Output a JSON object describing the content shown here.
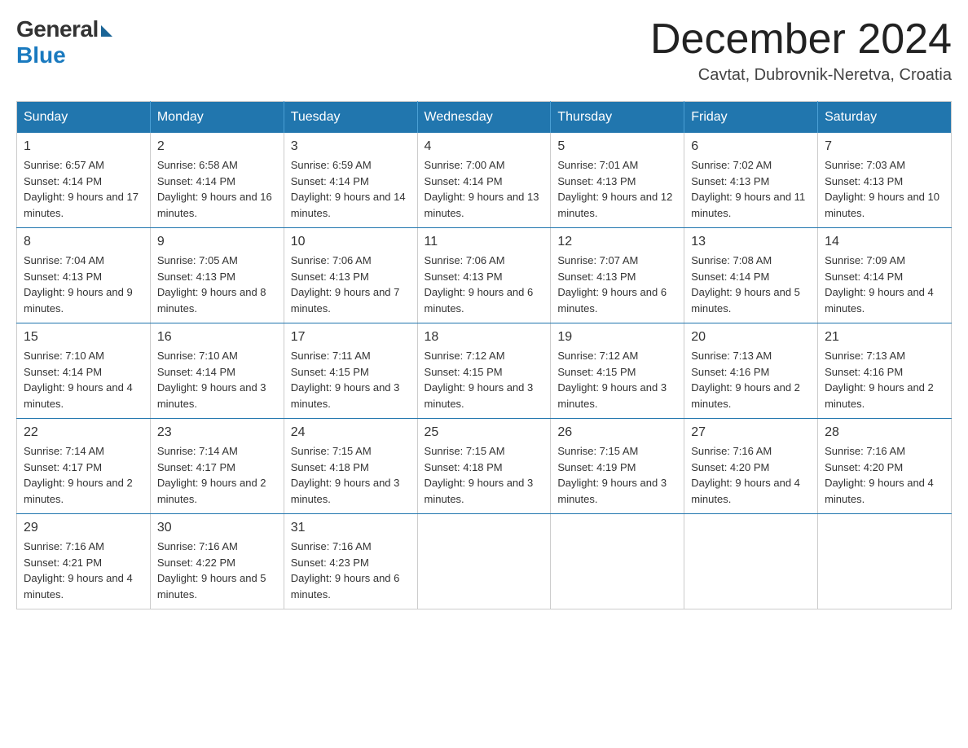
{
  "header": {
    "logo_general": "General",
    "logo_blue": "Blue",
    "month_year": "December 2024",
    "location": "Cavtat, Dubrovnik-Neretva, Croatia"
  },
  "days_of_week": [
    "Sunday",
    "Monday",
    "Tuesday",
    "Wednesday",
    "Thursday",
    "Friday",
    "Saturday"
  ],
  "weeks": [
    [
      {
        "day": "1",
        "sunrise": "6:57 AM",
        "sunset": "4:14 PM",
        "daylight": "9 hours and 17 minutes."
      },
      {
        "day": "2",
        "sunrise": "6:58 AM",
        "sunset": "4:14 PM",
        "daylight": "9 hours and 16 minutes."
      },
      {
        "day": "3",
        "sunrise": "6:59 AM",
        "sunset": "4:14 PM",
        "daylight": "9 hours and 14 minutes."
      },
      {
        "day": "4",
        "sunrise": "7:00 AM",
        "sunset": "4:14 PM",
        "daylight": "9 hours and 13 minutes."
      },
      {
        "day": "5",
        "sunrise": "7:01 AM",
        "sunset": "4:13 PM",
        "daylight": "9 hours and 12 minutes."
      },
      {
        "day": "6",
        "sunrise": "7:02 AM",
        "sunset": "4:13 PM",
        "daylight": "9 hours and 11 minutes."
      },
      {
        "day": "7",
        "sunrise": "7:03 AM",
        "sunset": "4:13 PM",
        "daylight": "9 hours and 10 minutes."
      }
    ],
    [
      {
        "day": "8",
        "sunrise": "7:04 AM",
        "sunset": "4:13 PM",
        "daylight": "9 hours and 9 minutes."
      },
      {
        "day": "9",
        "sunrise": "7:05 AM",
        "sunset": "4:13 PM",
        "daylight": "9 hours and 8 minutes."
      },
      {
        "day": "10",
        "sunrise": "7:06 AM",
        "sunset": "4:13 PM",
        "daylight": "9 hours and 7 minutes."
      },
      {
        "day": "11",
        "sunrise": "7:06 AM",
        "sunset": "4:13 PM",
        "daylight": "9 hours and 6 minutes."
      },
      {
        "day": "12",
        "sunrise": "7:07 AM",
        "sunset": "4:13 PM",
        "daylight": "9 hours and 6 minutes."
      },
      {
        "day": "13",
        "sunrise": "7:08 AM",
        "sunset": "4:14 PM",
        "daylight": "9 hours and 5 minutes."
      },
      {
        "day": "14",
        "sunrise": "7:09 AM",
        "sunset": "4:14 PM",
        "daylight": "9 hours and 4 minutes."
      }
    ],
    [
      {
        "day": "15",
        "sunrise": "7:10 AM",
        "sunset": "4:14 PM",
        "daylight": "9 hours and 4 minutes."
      },
      {
        "day": "16",
        "sunrise": "7:10 AM",
        "sunset": "4:14 PM",
        "daylight": "9 hours and 3 minutes."
      },
      {
        "day": "17",
        "sunrise": "7:11 AM",
        "sunset": "4:15 PM",
        "daylight": "9 hours and 3 minutes."
      },
      {
        "day": "18",
        "sunrise": "7:12 AM",
        "sunset": "4:15 PM",
        "daylight": "9 hours and 3 minutes."
      },
      {
        "day": "19",
        "sunrise": "7:12 AM",
        "sunset": "4:15 PM",
        "daylight": "9 hours and 3 minutes."
      },
      {
        "day": "20",
        "sunrise": "7:13 AM",
        "sunset": "4:16 PM",
        "daylight": "9 hours and 2 minutes."
      },
      {
        "day": "21",
        "sunrise": "7:13 AM",
        "sunset": "4:16 PM",
        "daylight": "9 hours and 2 minutes."
      }
    ],
    [
      {
        "day": "22",
        "sunrise": "7:14 AM",
        "sunset": "4:17 PM",
        "daylight": "9 hours and 2 minutes."
      },
      {
        "day": "23",
        "sunrise": "7:14 AM",
        "sunset": "4:17 PM",
        "daylight": "9 hours and 2 minutes."
      },
      {
        "day": "24",
        "sunrise": "7:15 AM",
        "sunset": "4:18 PM",
        "daylight": "9 hours and 3 minutes."
      },
      {
        "day": "25",
        "sunrise": "7:15 AM",
        "sunset": "4:18 PM",
        "daylight": "9 hours and 3 minutes."
      },
      {
        "day": "26",
        "sunrise": "7:15 AM",
        "sunset": "4:19 PM",
        "daylight": "9 hours and 3 minutes."
      },
      {
        "day": "27",
        "sunrise": "7:16 AM",
        "sunset": "4:20 PM",
        "daylight": "9 hours and 4 minutes."
      },
      {
        "day": "28",
        "sunrise": "7:16 AM",
        "sunset": "4:20 PM",
        "daylight": "9 hours and 4 minutes."
      }
    ],
    [
      {
        "day": "29",
        "sunrise": "7:16 AM",
        "sunset": "4:21 PM",
        "daylight": "9 hours and 4 minutes."
      },
      {
        "day": "30",
        "sunrise": "7:16 AM",
        "sunset": "4:22 PM",
        "daylight": "9 hours and 5 minutes."
      },
      {
        "day": "31",
        "sunrise": "7:16 AM",
        "sunset": "4:23 PM",
        "daylight": "9 hours and 6 minutes."
      },
      null,
      null,
      null,
      null
    ]
  ]
}
